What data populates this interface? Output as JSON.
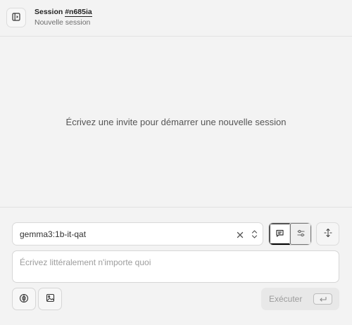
{
  "header": {
    "title_prefix": "Session ",
    "session_id": "#n685ia",
    "subtitle": "Nouvelle session",
    "toggle_icon": "sidebar-panel-icon"
  },
  "conversation": {
    "empty_text": "Écrivez une invite pour démarrer une nouvelle session"
  },
  "composer": {
    "model": {
      "value": "gemma3:1b-it-qat",
      "clear_icon": "close-icon",
      "chevron_icon": "chevrons-up-down-icon"
    },
    "modes": [
      {
        "name": "chat",
        "icon": "message-square-icon",
        "active": true
      },
      {
        "name": "settings",
        "icon": "sliders-icon",
        "active": false
      }
    ],
    "expand_icon": "move-vertical-icon",
    "prompt": {
      "placeholder": "Écrivez littéralement n'importe quoi",
      "value": ""
    },
    "tools_icon": "brain-icon",
    "image_icon": "image-icon",
    "run": {
      "label": "Exécuter",
      "enter_icon": "corner-down-left-icon"
    }
  },
  "colors": {
    "background": "#f3f3f3",
    "surface": "#ffffff",
    "border": "#d9d9d9",
    "text": "#2a2a2a",
    "muted_text": "#6d6d6d",
    "disabled_button": "#e8e8e8"
  }
}
